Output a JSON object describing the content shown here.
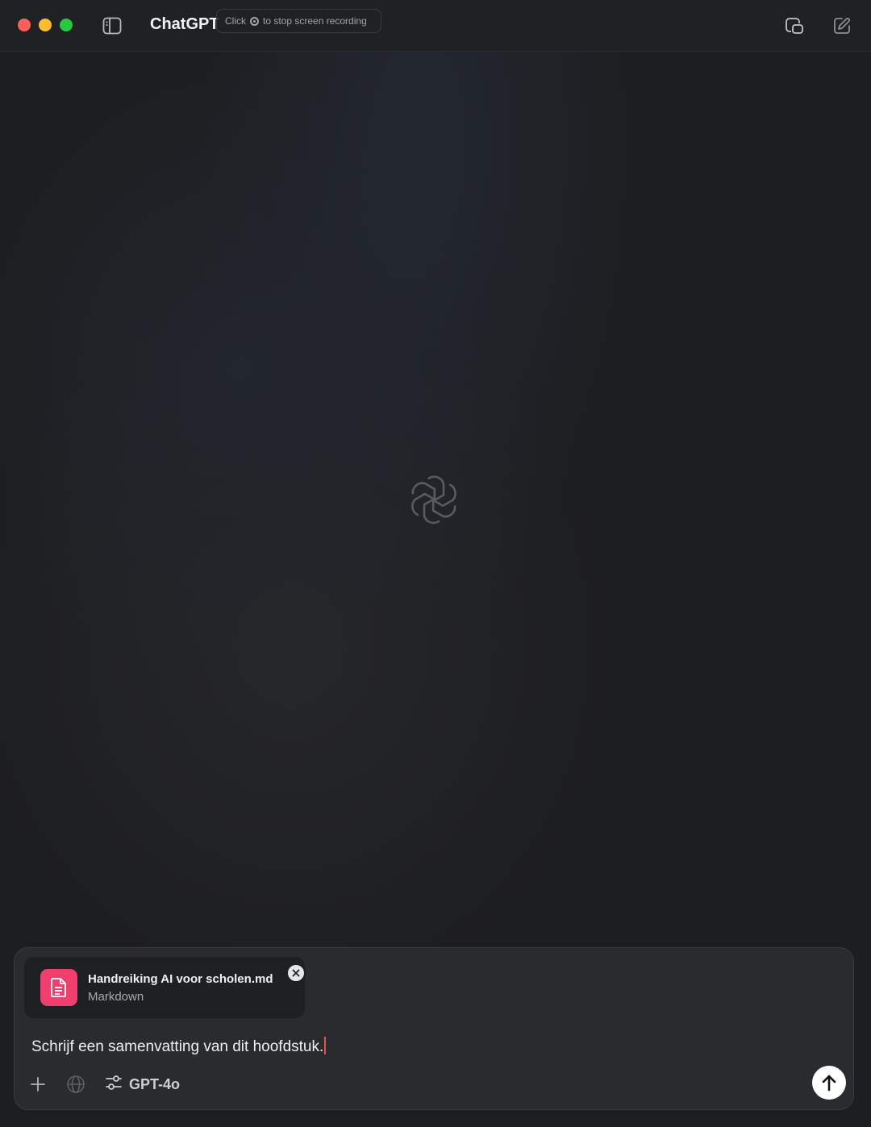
{
  "window": {
    "title": "ChatGPT",
    "recording_tip": {
      "prefix": "Click",
      "suffix": "to stop screen recording"
    }
  },
  "icons": {
    "sidebar_toggle": "sidebar-icon",
    "popout": "popout-window-icon",
    "new_chat": "compose-icon",
    "logo": "openai-logo-icon",
    "file": "document-icon",
    "remove": "close-icon",
    "add": "plus-icon",
    "web": "globe-icon",
    "model_settings": "sliders-icon",
    "send": "arrow-up-icon"
  },
  "composer": {
    "attachment": {
      "name": "Handreiking AI voor scholen.md",
      "type": "Markdown"
    },
    "prompt_text": "Schrijf een samenvatting van dit hoofdstuk.",
    "model_label": "GPT-4o"
  },
  "colors": {
    "background": "#1d1e21",
    "composer": "#2a2b2e",
    "file_icon": "#f03e6e",
    "send_button": "#ffffff"
  }
}
